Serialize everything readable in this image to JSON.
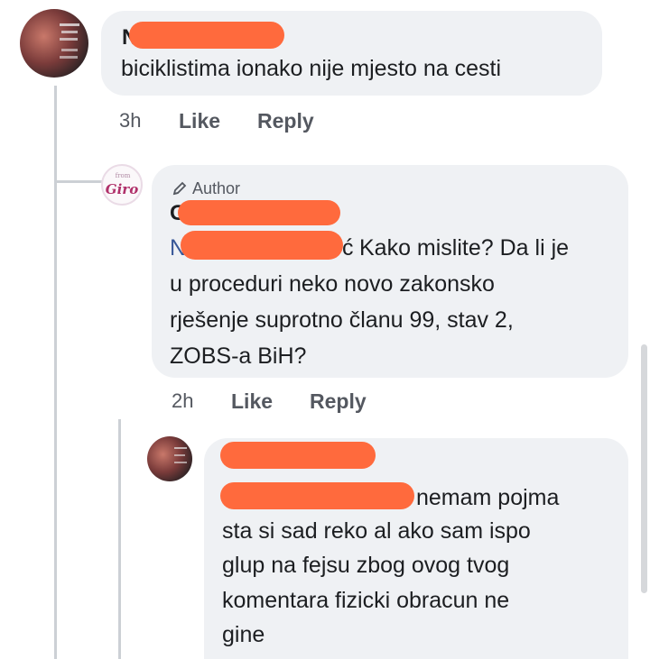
{
  "comment1": {
    "name_initial": "N",
    "text": "biciklistima ionako nije mjesto na cesti",
    "time": "3h",
    "like_label": "Like",
    "reply_label": "Reply"
  },
  "reply1": {
    "author_badge": "Author",
    "name_initial": "G",
    "mention_initial": "N",
    "mention_tail": "ć",
    "line1": "Kako mislite? Da li je",
    "line2": "u proceduri neko novo zakonsko",
    "line3": "rješenje suprotno članu 99, stav 2,",
    "line4": "ZOBS-a BiH?",
    "time": "2h",
    "like_label": "Like",
    "reply_label": "Reply",
    "logo_text": "Giro"
  },
  "reply2": {
    "line1": "nemam pojma",
    "line2": "sta si sad reko al ako sam ispo",
    "line3": "glup na fejsu zbog ovog tvog",
    "line4": "komentara fizicki obracun ne",
    "line5": "gine"
  }
}
